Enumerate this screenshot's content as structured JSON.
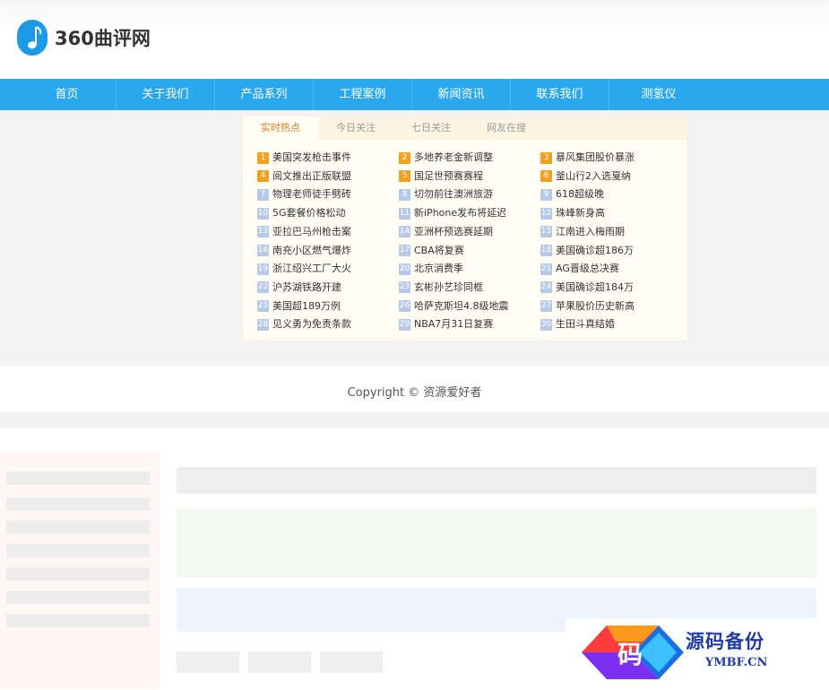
{
  "header": {
    "logo_text": "360曲评网"
  },
  "nav": [
    "首页",
    "关于我们",
    "产品系列",
    "工程案例",
    "新闻资讯",
    "联系我们",
    "测氢仪"
  ],
  "hot": {
    "tabs": [
      "实时热点",
      "今日关注",
      "七日关注",
      "网友在搜"
    ],
    "items": [
      {
        "rank": "1",
        "title": "美国突发枪击事件"
      },
      {
        "rank": "2",
        "title": "多地养老金新调整"
      },
      {
        "rank": "3",
        "title": "暴风集团股价暴涨"
      },
      {
        "rank": "4",
        "title": "阅文推出正版联盟"
      },
      {
        "rank": "5",
        "title": "国足世预赛赛程"
      },
      {
        "rank": "6",
        "title": "釜山行2入选戛纳"
      },
      {
        "rank": "7",
        "title": "物理老师徒手劈砖"
      },
      {
        "rank": "8",
        "title": "切勿前往澳洲旅游"
      },
      {
        "rank": "9",
        "title": "618超级晚"
      },
      {
        "rank": "10",
        "title": "5G套餐价格松动"
      },
      {
        "rank": "11",
        "title": "新iPhone发布将延迟"
      },
      {
        "rank": "12",
        "title": "珠峰新身高"
      },
      {
        "rank": "13",
        "title": "亚拉巴马州枪击案"
      },
      {
        "rank": "14",
        "title": "亚洲杯预选赛延期"
      },
      {
        "rank": "15",
        "title": "江南进入梅雨期"
      },
      {
        "rank": "16",
        "title": "南充小区燃气爆炸"
      },
      {
        "rank": "17",
        "title": "CBA将复赛"
      },
      {
        "rank": "18",
        "title": "美国确诊超186万"
      },
      {
        "rank": "19",
        "title": "浙江绍兴工厂大火"
      },
      {
        "rank": "20",
        "title": "北京消费季"
      },
      {
        "rank": "21",
        "title": "AG晋级总决赛"
      },
      {
        "rank": "22",
        "title": "沪苏湖铁路开建"
      },
      {
        "rank": "23",
        "title": "玄彬孙艺珍同框"
      },
      {
        "rank": "24",
        "title": "美国确诊超184万"
      },
      {
        "rank": "25",
        "title": "美国超189万例"
      },
      {
        "rank": "26",
        "title": "哈萨克斯坦4.8级地震"
      },
      {
        "rank": "27",
        "title": "苹果股价历史新高"
      },
      {
        "rank": "28",
        "title": "见义勇为免责条款"
      },
      {
        "rank": "29",
        "title": "NBA7月31日复赛"
      },
      {
        "rank": "30",
        "title": "生田斗真结婚"
      }
    ]
  },
  "footer": {
    "copyright": "Copyright © 资源爱好者"
  },
  "watermark": {
    "cn": "源码备份",
    "en": "YMBF.CN",
    "glyph": "码"
  },
  "colors": {
    "nav": "#2aa8ee",
    "rank_top": "#f2a01f",
    "rank_normal": "#b7c9e8",
    "active_tab": "#e27d1c"
  }
}
